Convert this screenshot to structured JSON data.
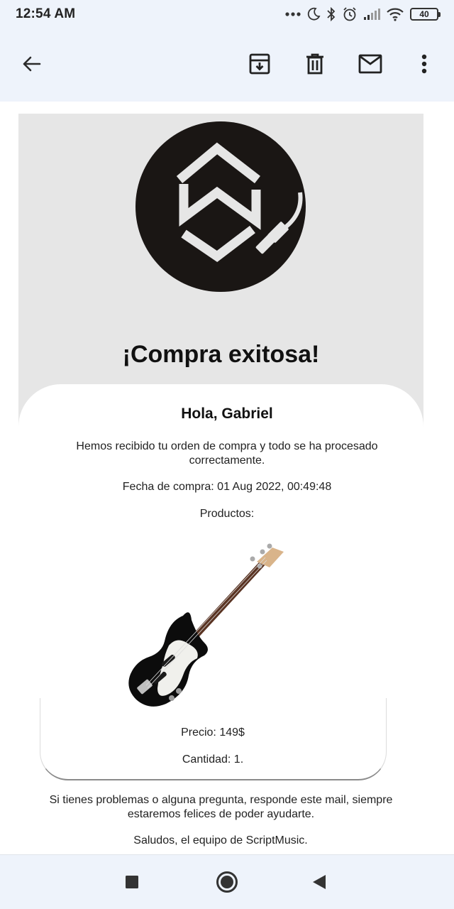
{
  "status_bar": {
    "time": "12:54 AM",
    "battery": "40",
    "icons": [
      "more-dots-icon",
      "moon-icon",
      "bluetooth-icon",
      "alarm-icon",
      "signal-icon",
      "wifi-icon",
      "battery-icon"
    ]
  },
  "toolbar": {
    "back_icon": "arrow-back-icon",
    "archive_icon": "archive-icon",
    "delete_icon": "trash-icon",
    "mark_unread_icon": "mail-icon",
    "more_icon": "more-vertical-icon"
  },
  "email": {
    "title": "¡Compra exitosa!",
    "greeting": "Hola, Gabriel",
    "message": "Hemos recibido tu orden de compra y todo se ha procesado correctamente.",
    "purchase_date": "Fecha de compra: 01 Aug 2022, 00:49:48",
    "products_label": "Productos:",
    "product": {
      "image": "bass-guitar-image",
      "price": "Precio: 149$",
      "quantity": "Cantidad: 1."
    },
    "help_text": "Si tienes problemas o alguna pregunta, responde este mail, siempre estaremos felices de poder ayudarte.",
    "signoff": "Saludos, el equipo de ScriptMusic."
  },
  "nav_bar": {
    "recents_icon": "square-icon",
    "home_icon": "circle-icon",
    "back_icon": "triangle-back-icon"
  },
  "colors": {
    "chrome_bg": "#eef3fb",
    "hero_bg": "#e6e6e6",
    "logo_dark": "#1a1614"
  }
}
